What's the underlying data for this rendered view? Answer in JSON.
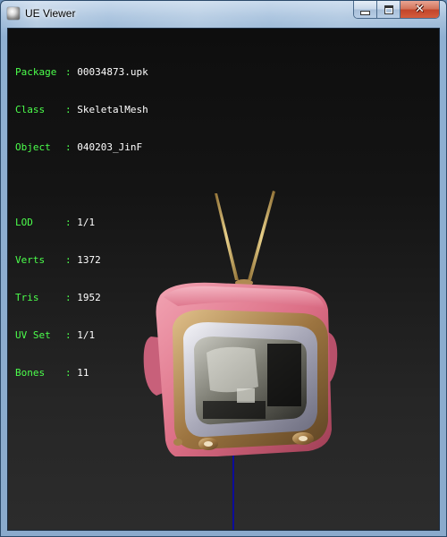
{
  "window": {
    "title": "UE Viewer"
  },
  "titlebar_buttons": {
    "minimize_icon": "minimize-icon",
    "maximize_icon": "maximize-icon",
    "close_icon": "close-icon",
    "close_glyph": "✕"
  },
  "info": {
    "package": {
      "label": "Package",
      "value": "00034873.upk"
    },
    "class": {
      "label": "Class",
      "value": "SkeletalMesh"
    },
    "object": {
      "label": "Object",
      "value": "040203_JinF"
    },
    "lod": {
      "label": "LOD",
      "value": "1/1"
    },
    "verts": {
      "label": "Verts",
      "value": "1372"
    },
    "tris": {
      "label": "Tris",
      "value": "1952"
    },
    "uvset": {
      "label": "UV Set",
      "value": "1/1"
    },
    "bones": {
      "label": "Bones",
      "value": "11"
    }
  },
  "colors": {
    "label_green": "#4cff4c",
    "value_white": "#ffffff",
    "axis_blue": "#0c0c9a",
    "tv_pink": "#e07a8e",
    "tv_gold": "#b08a52"
  }
}
